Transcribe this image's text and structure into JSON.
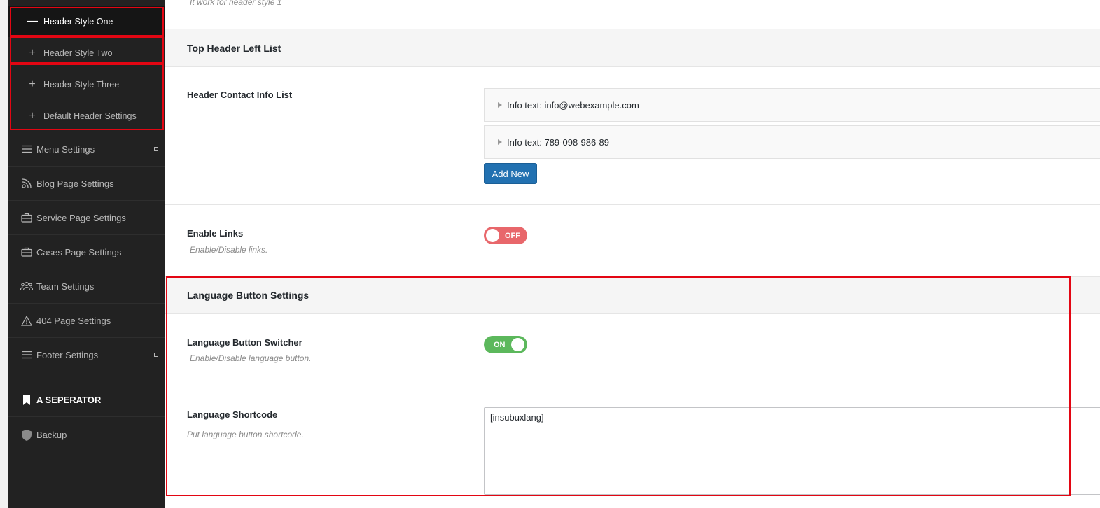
{
  "sidebar": {
    "sub_items": [
      {
        "label": "Header Style One",
        "icon": "minus-icon"
      },
      {
        "label": "Header Style Two",
        "icon": "plus-icon"
      },
      {
        "label": "Header Style Three",
        "icon": "plus-icon"
      },
      {
        "label": "Default Header Settings",
        "icon": "plus-icon"
      }
    ],
    "menu_items": [
      {
        "label": "Menu Settings",
        "icon": "hamburger-icon"
      },
      {
        "label": "Blog Page Settings",
        "icon": "rss-icon"
      },
      {
        "label": "Service Page Settings",
        "icon": "briefcase-icon"
      },
      {
        "label": "Cases Page Settings",
        "icon": "briefcase-icon"
      },
      {
        "label": "Team Settings",
        "icon": "users-icon"
      },
      {
        "label": "404 Page Settings",
        "icon": "warning-icon"
      },
      {
        "label": "Footer Settings",
        "icon": "hamburger-icon"
      }
    ],
    "separator": "A SEPERATOR",
    "backup": "Backup"
  },
  "main": {
    "top_cut_text": "It work for header style 1",
    "top_header": {
      "title": "Top Header Left List",
      "contact_list_label": "Header Contact Info List",
      "items": [
        "Info text: info@webexample.com",
        "Info text: 789-098-986-89"
      ],
      "add_new": "Add New",
      "enable_links_label": "Enable Links",
      "enable_links_desc": "Enable/Disable links.",
      "enable_links_state": "OFF"
    },
    "language": {
      "title": "Language Button Settings",
      "switcher_label": "Language Button Switcher",
      "switcher_desc": "Enable/Disable language button.",
      "switcher_state": "ON",
      "shortcode_label": "Language Shortcode",
      "shortcode_desc": "Put language button shortcode.",
      "shortcode_value": "[insubuxlang]"
    }
  },
  "colors": {
    "sidebar_bg": "#222222",
    "accent_blue": "#2271b1",
    "toggle_off": "#e8676b",
    "toggle_on": "#5cb85c",
    "highlight_red": "#e30613"
  }
}
